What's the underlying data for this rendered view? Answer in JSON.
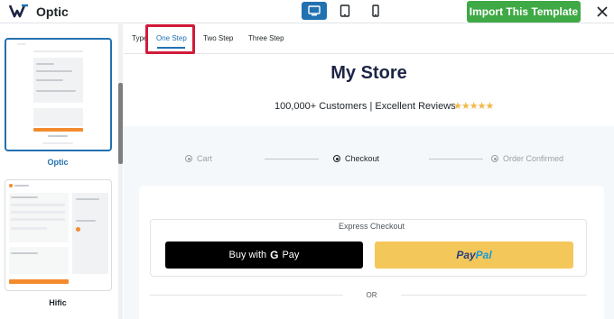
{
  "app": {
    "title": "Optic",
    "import_label": "Import This Template",
    "devices": [
      {
        "name": "desktop",
        "active": true
      },
      {
        "name": "tablet",
        "active": false
      },
      {
        "name": "mobile",
        "active": false
      }
    ]
  },
  "sidebar": {
    "templates": [
      {
        "label": "Optic",
        "selected": true
      },
      {
        "label": "Hific",
        "selected": false
      }
    ]
  },
  "tabs": [
    {
      "label": "Type",
      "active": false
    },
    {
      "label": "One Step",
      "active": true
    },
    {
      "label": "Two Step",
      "active": false
    },
    {
      "label": "Three Step",
      "active": false
    }
  ],
  "preview": {
    "store_title": "My Store",
    "tagline": "100,000+ Customers | Excellent Reviews",
    "stars": "★★★★★",
    "steps": [
      {
        "label": "Cart",
        "active": false
      },
      {
        "label": "Checkout",
        "active": true
      },
      {
        "label": "Order Confirmed",
        "active": false
      }
    ],
    "express_checkout": "Express Checkout",
    "gpay": {
      "prefix": "Buy with",
      "g": "G",
      "pay": "Pay"
    },
    "paypal": {
      "pay": "Pay",
      "pal": "Pal"
    },
    "or_label": "OR"
  },
  "colors": {
    "accent": "#2271b1",
    "import_green": "#3fa946",
    "highlight_red": "#d11a3a",
    "paypal_yellow": "#f4c75a",
    "store_title": "#1d2545"
  }
}
